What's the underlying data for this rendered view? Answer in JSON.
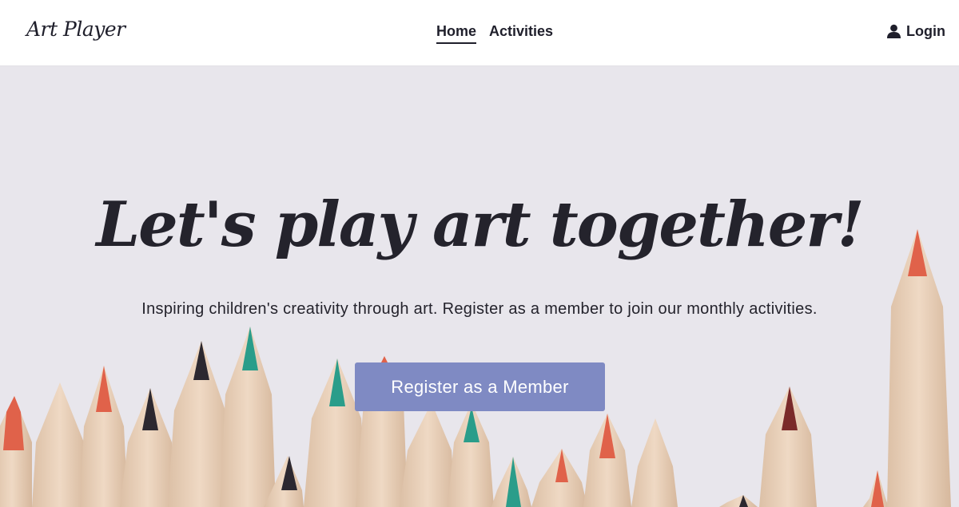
{
  "brand": {
    "name": "Art Player"
  },
  "nav": {
    "links": [
      {
        "label": "Home",
        "active": true
      },
      {
        "label": "Activities",
        "active": false
      }
    ],
    "login_label": "Login",
    "login_icon": "user-icon"
  },
  "hero": {
    "title": "Let's play art together!",
    "subtitle": "Inspiring children's creativity through art. Register as a member to join our monthly activities.",
    "cta_label": "Register as a Member"
  },
  "colors": {
    "background": "#e8e6ec",
    "cta": "#7f8ac3",
    "pencil_wood": "#e6cdb5",
    "pencil_red": "#e0624a",
    "pencil_teal": "#2a9d8a",
    "pencil_dark": "#2c2830"
  }
}
